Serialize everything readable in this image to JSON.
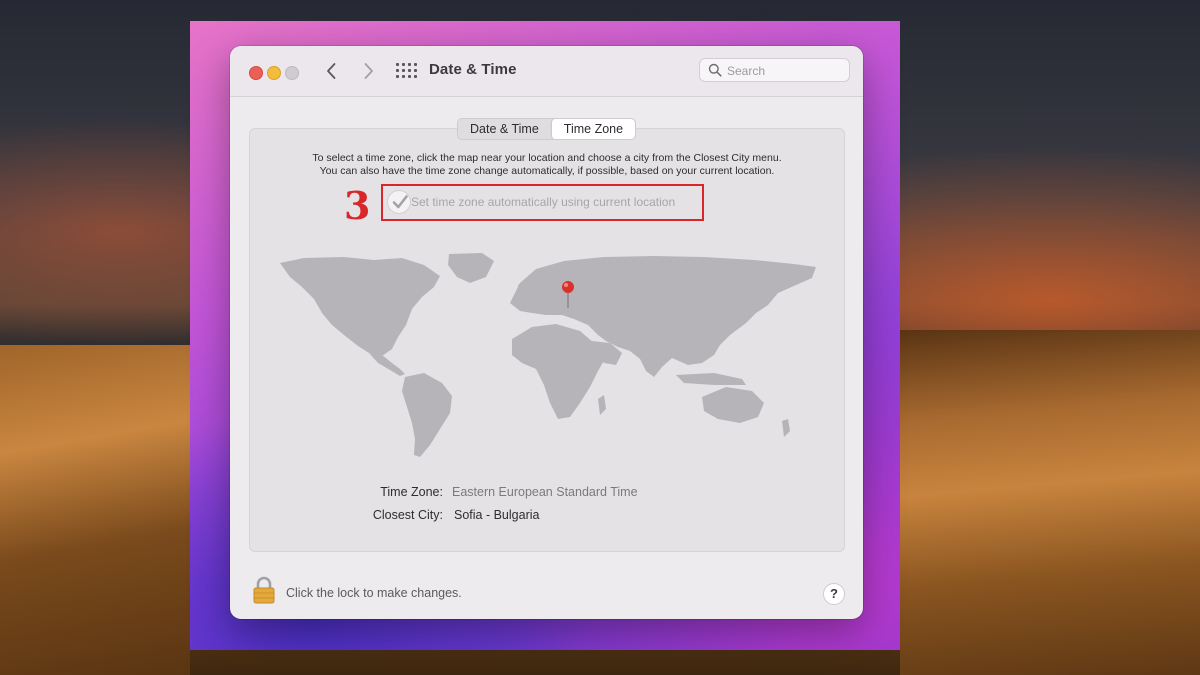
{
  "window": {
    "title": "Date & Time",
    "search_placeholder": "Search"
  },
  "nav": {
    "back_glyph": "‹",
    "forward_glyph": "›"
  },
  "tabs": [
    {
      "label": "Date & Time",
      "selected": false
    },
    {
      "label": "Time Zone",
      "selected": true
    }
  ],
  "time_zone_panel": {
    "instructions_line1": "To select a time zone, click the map near your location and choose a city from the Closest City menu.",
    "instructions_line2": "You can also have the time zone change automatically, if possible, based on your current location.",
    "auto_checkbox_label": "Set time zone automatically using current location",
    "auto_checkbox_checked": true,
    "time_zone_label": "Time Zone:",
    "time_zone_value": "Eastern European Standard Time",
    "closest_city_label": "Closest City:",
    "closest_city_value": "Sofia - Bulgaria"
  },
  "annotation": {
    "step_number": "3",
    "color": "#d9262b"
  },
  "footer": {
    "lock_text": "Click the lock to make changes.",
    "help_label": "?"
  },
  "icons": {
    "traffic_lights": [
      "close-button",
      "minimize-button",
      "zoom-button"
    ],
    "grid": "show-all-grid-icon",
    "search": "search-icon",
    "lock": "lock-icon",
    "pin": "location-pin-icon"
  }
}
